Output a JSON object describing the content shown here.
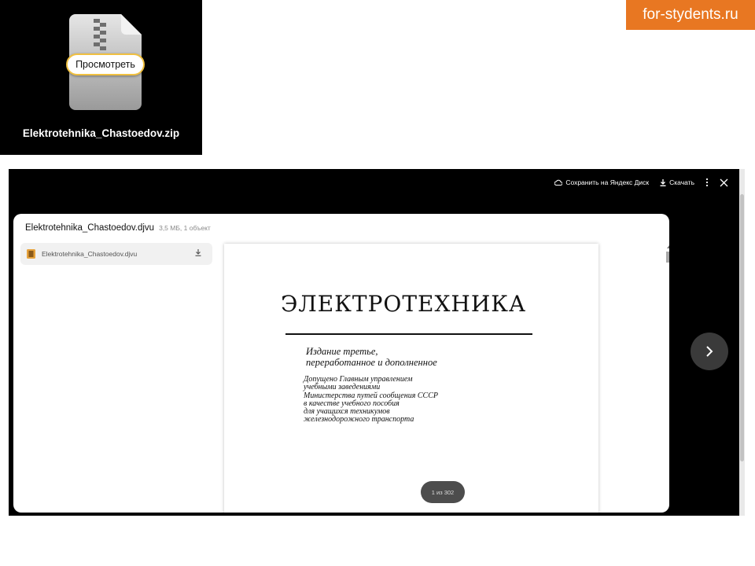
{
  "thumbnail": {
    "preview_label": "Просмотреть",
    "file_name": "Elektrotehnika_Chastoedov.zip",
    "icon": "zip-archive-icon"
  },
  "site_tag": "for-stydents.ru",
  "viewer": {
    "toolbar": {
      "save_label": "Сохранить на Яндекс Диск",
      "download_label": "Скачать"
    },
    "archive": {
      "title": "Elektrotehnika_Chastoedov.djvu",
      "meta": "3,5 МБ, 1 объект",
      "files": [
        {
          "name": "Elektrotehnika_Chastoedov.djvu",
          "icon": "djvu-file-icon"
        }
      ]
    },
    "document": {
      "title": "ЭЛЕКТРОТЕХНИКА",
      "edition_line1": "Издание третье,",
      "edition_line2": "переработанное и дополненное",
      "approval": [
        "Допущено Главным управлением",
        "учебными заведениями",
        "Министерства путей сообщения СССР",
        "в качестве учебного пособия",
        "для учащихся техникумов",
        "железнодорожного транспорта"
      ]
    },
    "page_indicator": "1 из 302"
  },
  "colors": {
    "site_tag": "#e87722",
    "preview_border": "#f0c040",
    "viewer_bg": "#000000"
  }
}
